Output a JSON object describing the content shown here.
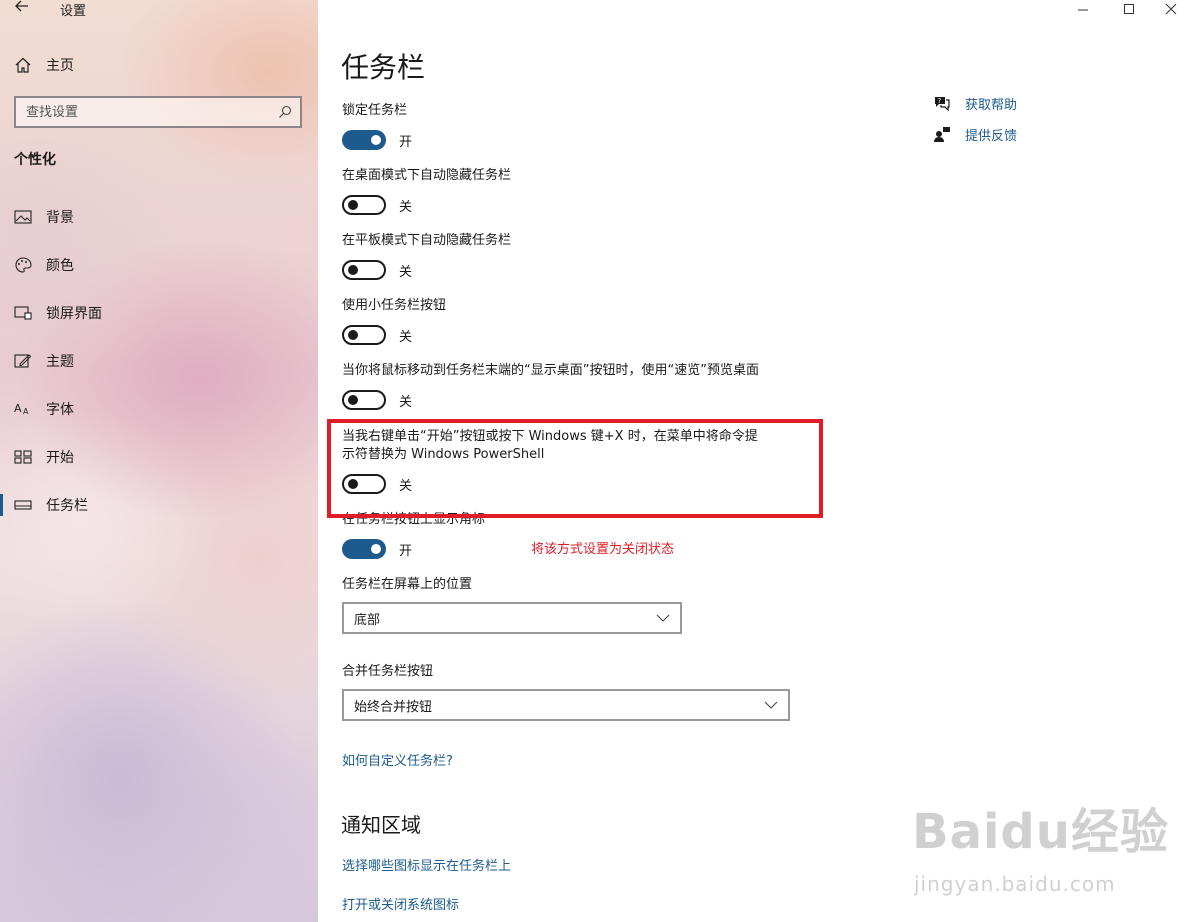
{
  "window": {
    "title": "设置",
    "minimize_icon": "minimize-icon",
    "maximize_icon": "maximize-icon",
    "close_icon": "close-icon"
  },
  "sidebar": {
    "home_label": "主页",
    "search_placeholder": "查找设置",
    "section_title": "个性化",
    "items": [
      {
        "label": "背景",
        "icon": "picture-icon"
      },
      {
        "label": "颜色",
        "icon": "palette-icon"
      },
      {
        "label": "锁屏界面",
        "icon": "lock-screen-icon"
      },
      {
        "label": "主题",
        "icon": "theme-icon"
      },
      {
        "label": "字体",
        "icon": "font-icon"
      },
      {
        "label": "开始",
        "icon": "start-icon"
      },
      {
        "label": "任务栏",
        "icon": "taskbar-icon",
        "active": true
      }
    ]
  },
  "main": {
    "title": "任务栏",
    "settings": [
      {
        "label": "锁定任务栏",
        "state": "开",
        "on": true
      },
      {
        "label": "在桌面模式下自动隐藏任务栏",
        "state": "关",
        "on": false
      },
      {
        "label": "在平板模式下自动隐藏任务栏",
        "state": "关",
        "on": false
      },
      {
        "label": "使用小任务栏按钮",
        "state": "关",
        "on": false
      },
      {
        "label": "当你将鼠标移动到任务栏末端的“显示桌面”按钮时，使用“速览”预览桌面",
        "state": "关",
        "on": false
      },
      {
        "label_line1": "当我右键单击“开始”按钮或按下 Windows 键+X 时，在菜单中将命令提",
        "label_line2": "示符替换为 Windows PowerShell",
        "state": "关",
        "on": false
      },
      {
        "label": "在任务栏按钮上显示角标",
        "state": "开",
        "on": true
      }
    ],
    "position": {
      "label": "任务栏在屏幕上的位置",
      "value": "底部"
    },
    "combine": {
      "label": "合并任务栏按钮",
      "value": "始终合并按钮"
    },
    "customize_link": "如何自定义任务栏?",
    "notify_title": "通知区域",
    "notify_links": [
      "选择哪些图标显示在任务栏上",
      "打开或关闭系统图标"
    ]
  },
  "help": {
    "get_help": "获取帮助",
    "feedback": "提供反馈"
  },
  "annotation": {
    "text": "将该方式设置为关闭状态",
    "color": "#e01d26"
  },
  "watermark": {
    "logo": "Baidu经验",
    "site": "jingyan.baidu.com"
  },
  "colors": {
    "accent": "#1d5b8f",
    "highlight": "#e01d26"
  }
}
